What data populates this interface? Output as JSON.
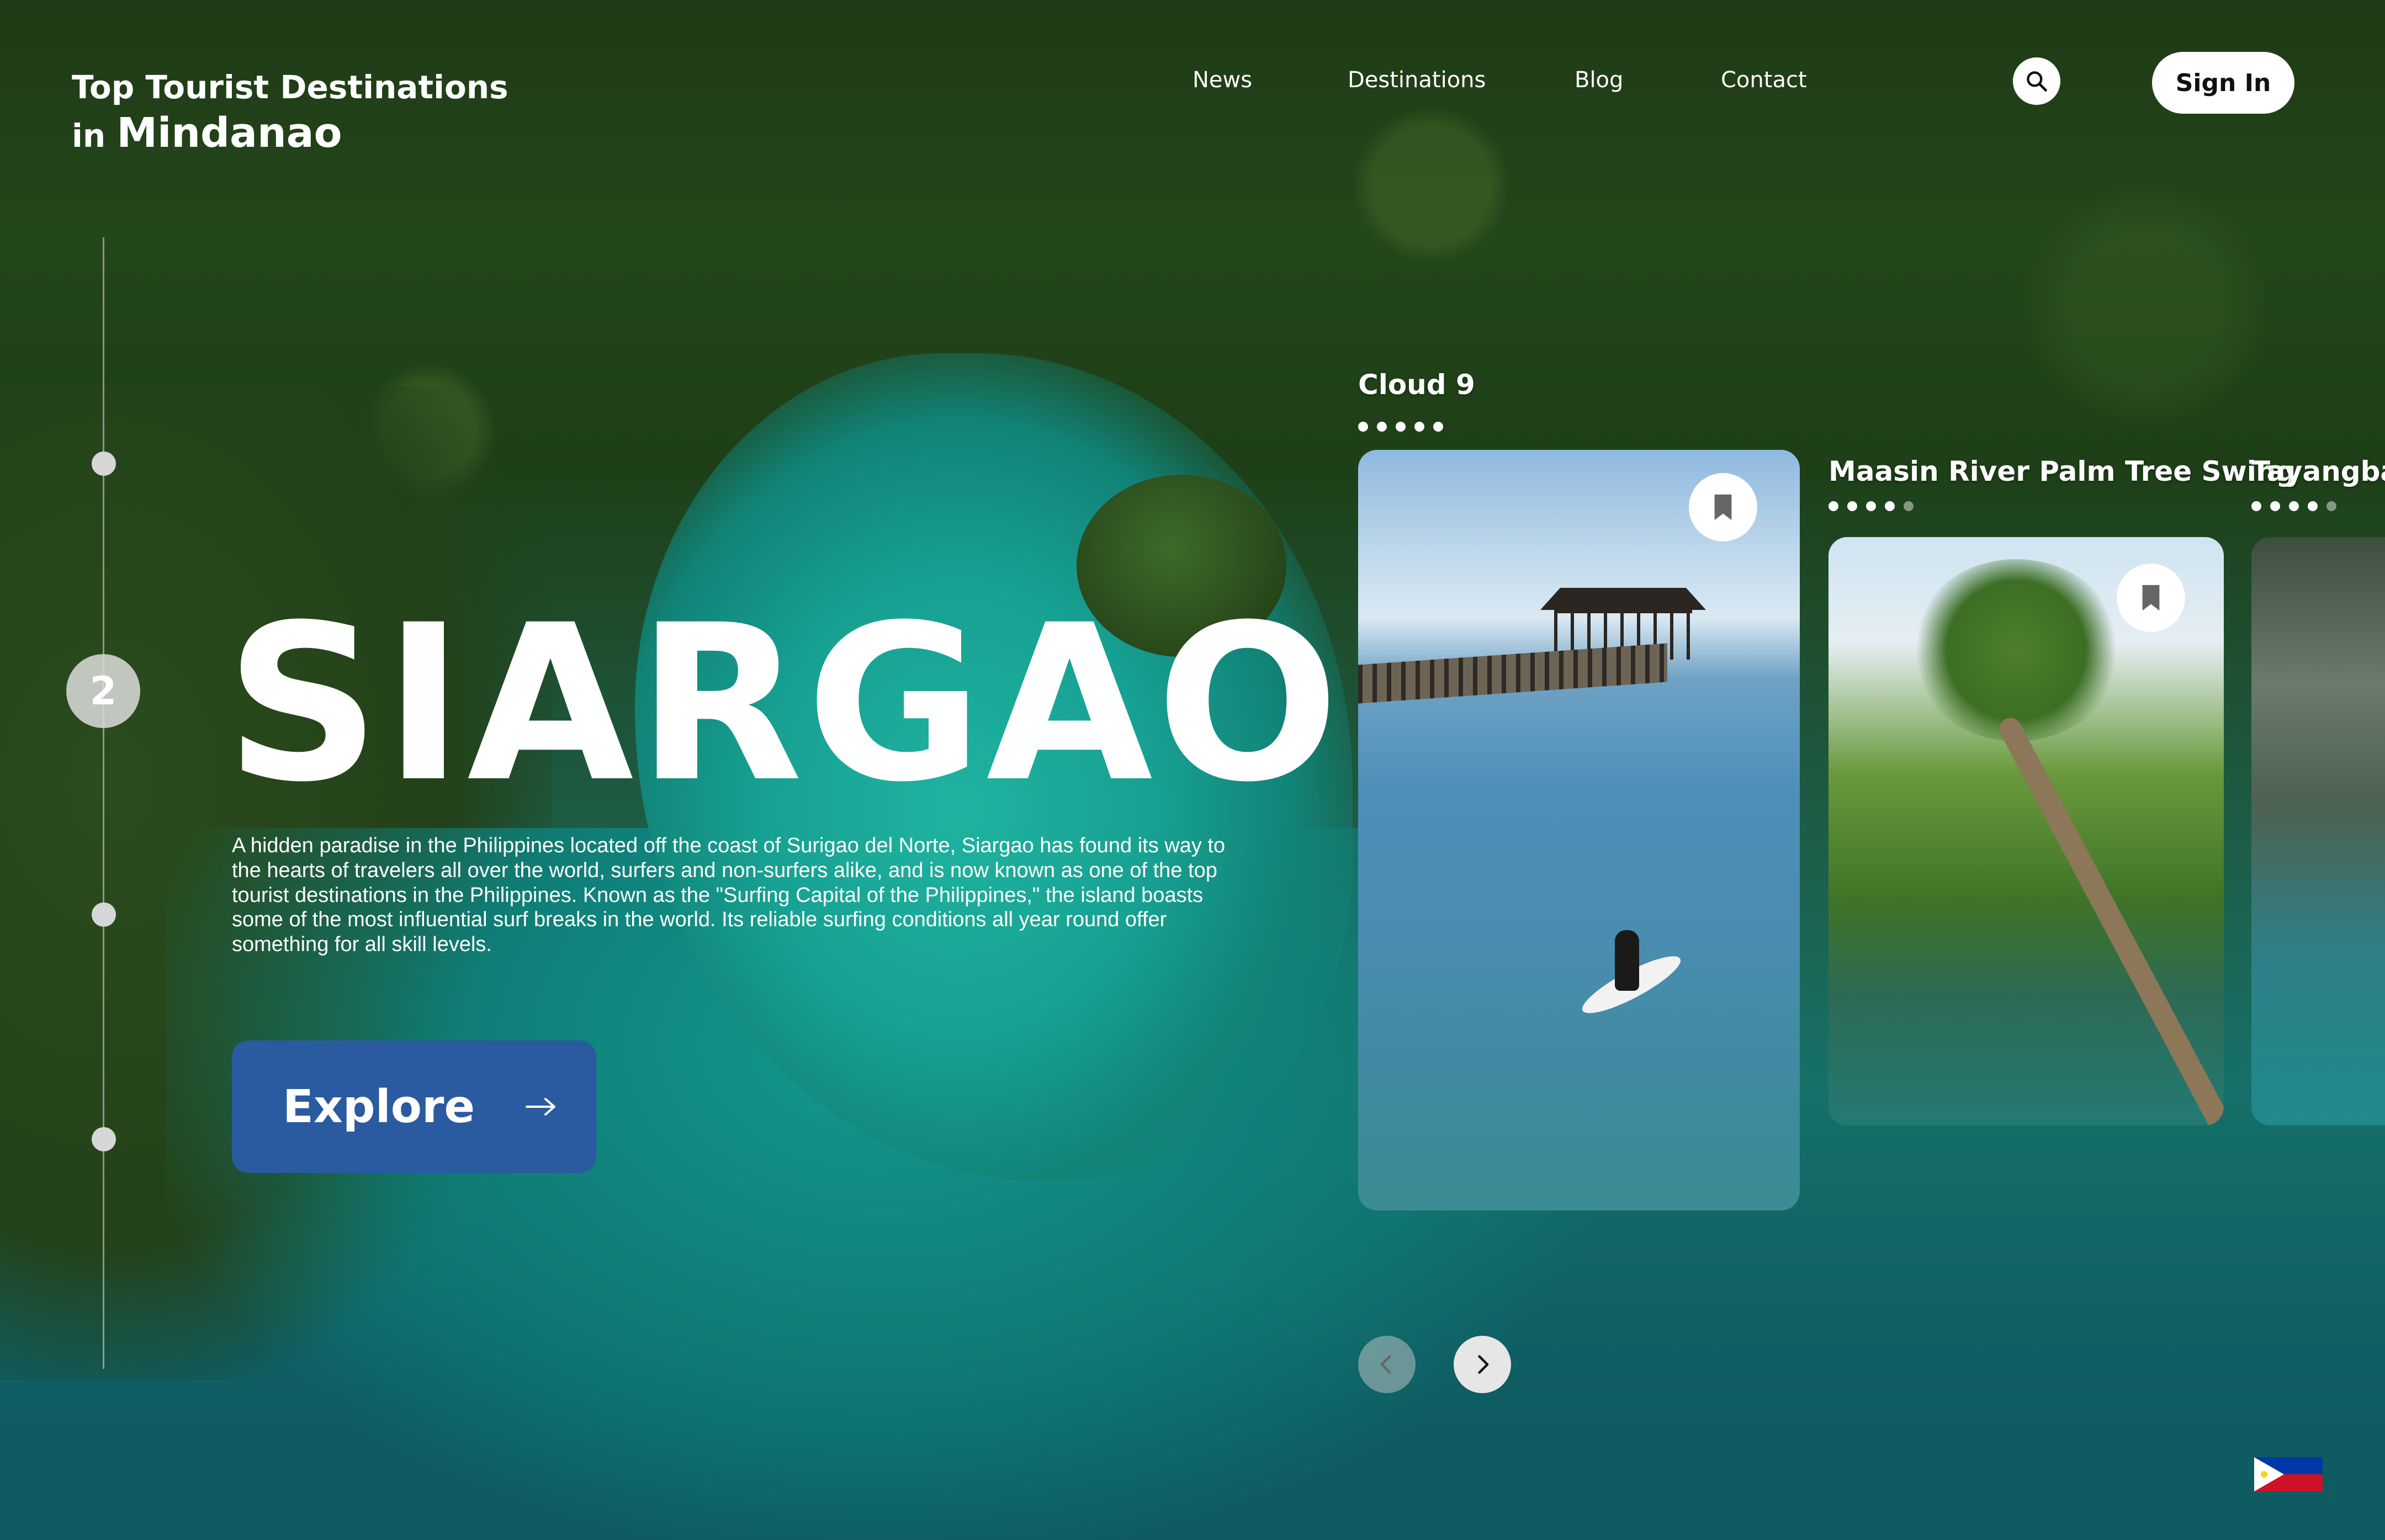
{
  "brand": {
    "line1": "Top Tourist Destinations",
    "line2_prefix": "in",
    "line2_main": "Mindanao"
  },
  "nav": {
    "items": [
      "News",
      "Destinations",
      "Blog",
      "Contact"
    ]
  },
  "header": {
    "search_icon": "search-icon",
    "signin_label": "Sign In"
  },
  "timeline": {
    "active_step": "2"
  },
  "hero": {
    "title": "SIARGAO",
    "description": "A hidden paradise in the Philippines located off the coast of Surigao del Norte, Siargao has found its way to the hearts of travelers all over the world, surfers and non-surfers alike, and is now known as one of the top tourist destinations in the Philippines. Known as the \"Surfing Capital of the Philippines,\" the island boasts some of the most influential surf breaks in the world. Its reliable surfing conditions all year round offer something for all skill levels.",
    "cta_label": "Explore"
  },
  "cards": [
    {
      "title": "Cloud 9",
      "rating": 5
    },
    {
      "title": "Maasin River Palm Tree Swing",
      "rating": 4
    },
    {
      "title": "Tayangban",
      "rating": 4
    }
  ],
  "colors": {
    "accent": "#2a5aa0",
    "flag_blue": "#0038a8",
    "flag_red": "#ce1126",
    "flag_sun": "#fcd116"
  }
}
